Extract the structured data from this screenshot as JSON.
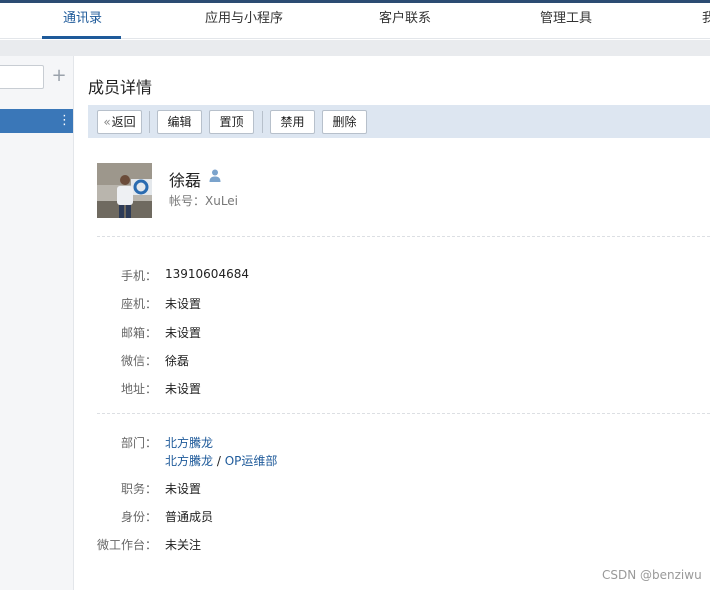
{
  "topnav": {
    "items": [
      {
        "label": "通讯录",
        "active": true
      },
      {
        "label": "应用与小程序",
        "active": false
      },
      {
        "label": "客户联系",
        "active": false
      },
      {
        "label": "管理工具",
        "active": false
      },
      {
        "label": "我",
        "active": false
      }
    ]
  },
  "sidebar": {
    "add_label": "+",
    "more_label": "⋮"
  },
  "page": {
    "title": "成员详情"
  },
  "toolbar": {
    "back_label": "返回",
    "edit_label": "编辑",
    "pin_label": "置顶",
    "disable_label": "禁用",
    "delete_label": "删除"
  },
  "member": {
    "name": "徐磊",
    "account": "帐号：XuLei"
  },
  "contact": {
    "mobile_label": "手机：",
    "mobile_value": "13910604684",
    "phone_label": "座机：",
    "phone_value": "未设置",
    "email_label": "邮箱：",
    "email_value": "未设置",
    "wechat_label": "微信：",
    "wechat_value": "徐磊",
    "address_label": "地址：",
    "address_value": "未设置"
  },
  "org": {
    "dept_label": "部门：",
    "dept_line1": "北方騰龙",
    "dept_line2_a": "北方騰龙",
    "dept_sep": " / ",
    "dept_line2_b": "OP运维部",
    "title_label": "职务：",
    "title_value": "未设置",
    "identity_label": "身份：",
    "identity_value": "普通成员",
    "workbench_label": "微工作台：",
    "workbench_value": "未关注"
  },
  "watermark": "CSDN @benziwu",
  "colors": {
    "accent": "#1e5a9a",
    "selected_dept": "#3a77b8",
    "toolbar_bg": "#dde6f1"
  }
}
